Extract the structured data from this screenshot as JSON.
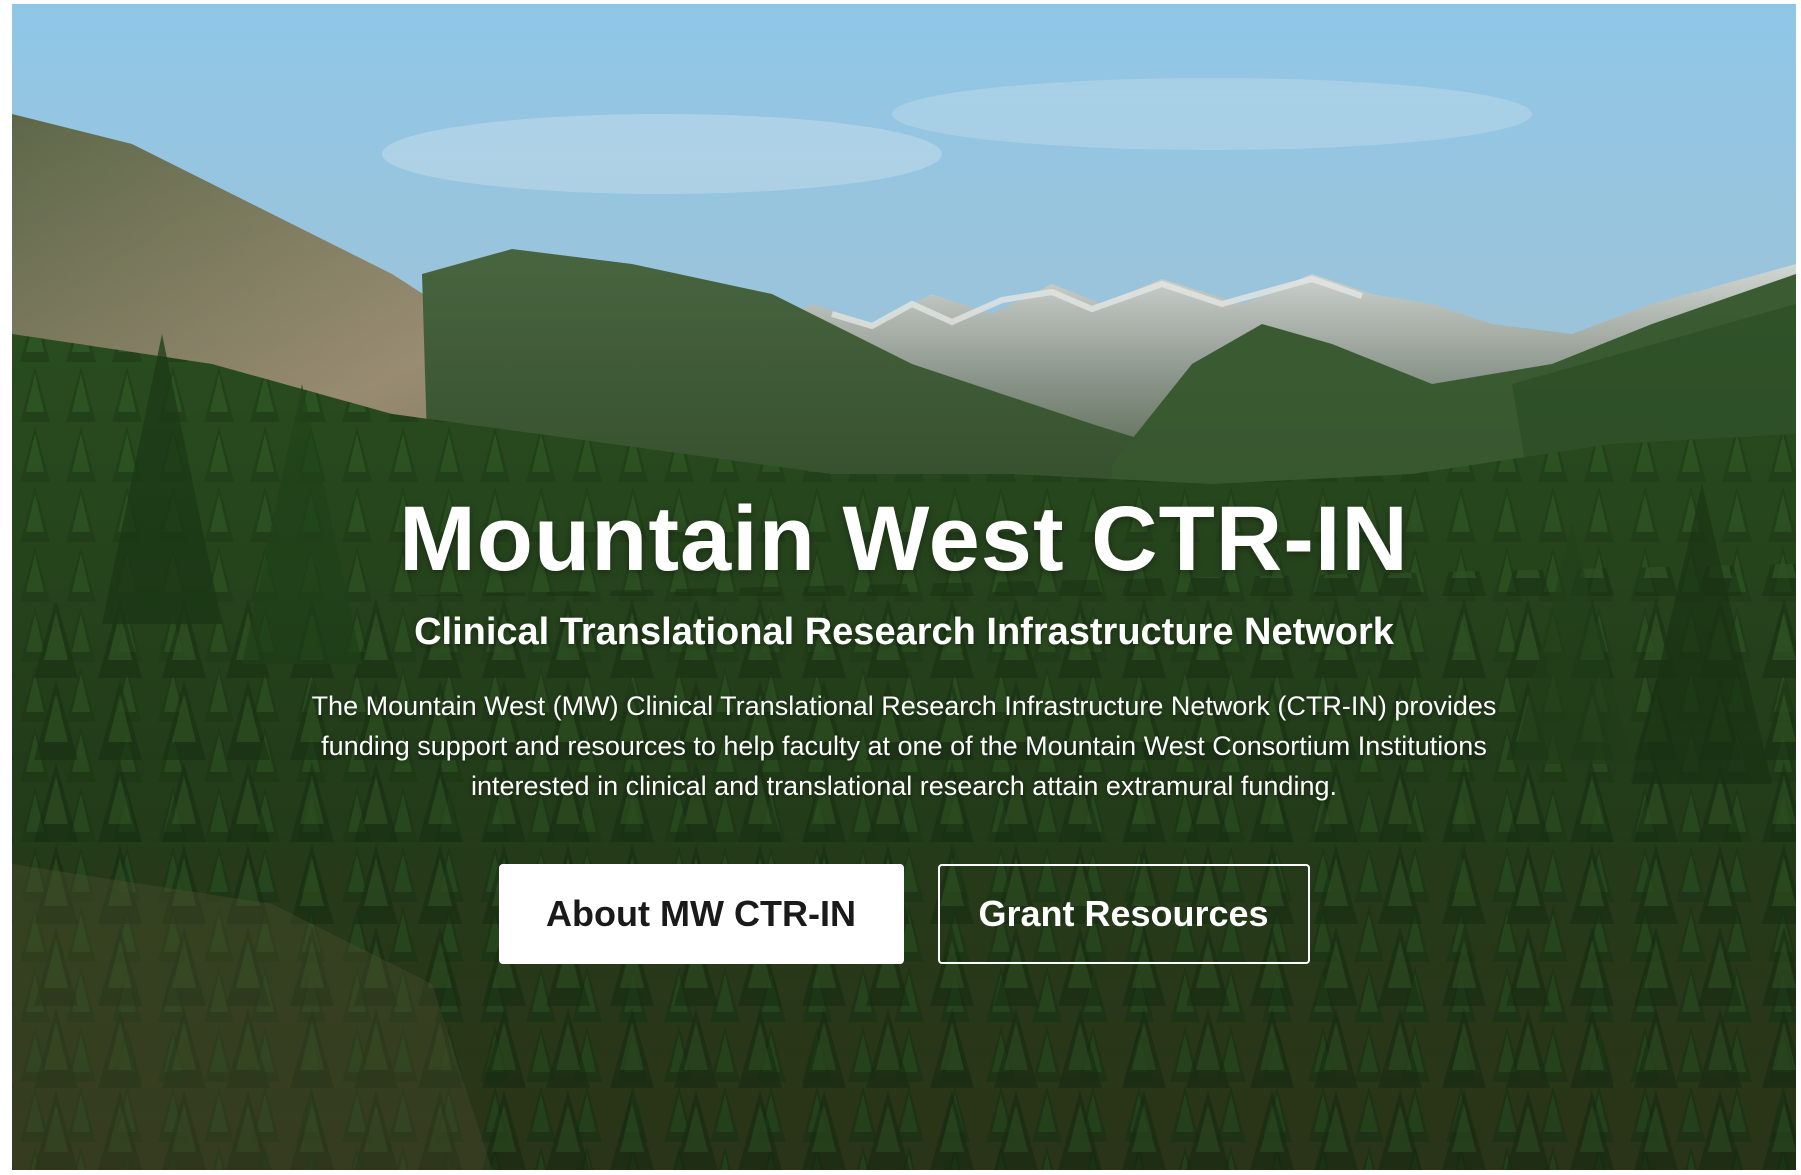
{
  "hero": {
    "title": "Mountain West CTR-IN",
    "subtitle": "Clinical Translational Research Infrastructure Network",
    "description": "The Mountain West (MW) Clinical Translational Research Infrastructure Network (CTR-IN) provides funding support and resources to help faculty at one of the Mountain West Consortium Institutions interested in clinical and translational research attain extramural funding.",
    "background": "mountain-forest-landscape-photo"
  },
  "buttons": {
    "about_label": "About MW CTR-IN",
    "grants_label": "Grant Resources"
  },
  "colors": {
    "sky": "#bfe0f2",
    "forest": "#2f5a23",
    "text": "#ffffff",
    "button_text": "#1a1a1a"
  }
}
